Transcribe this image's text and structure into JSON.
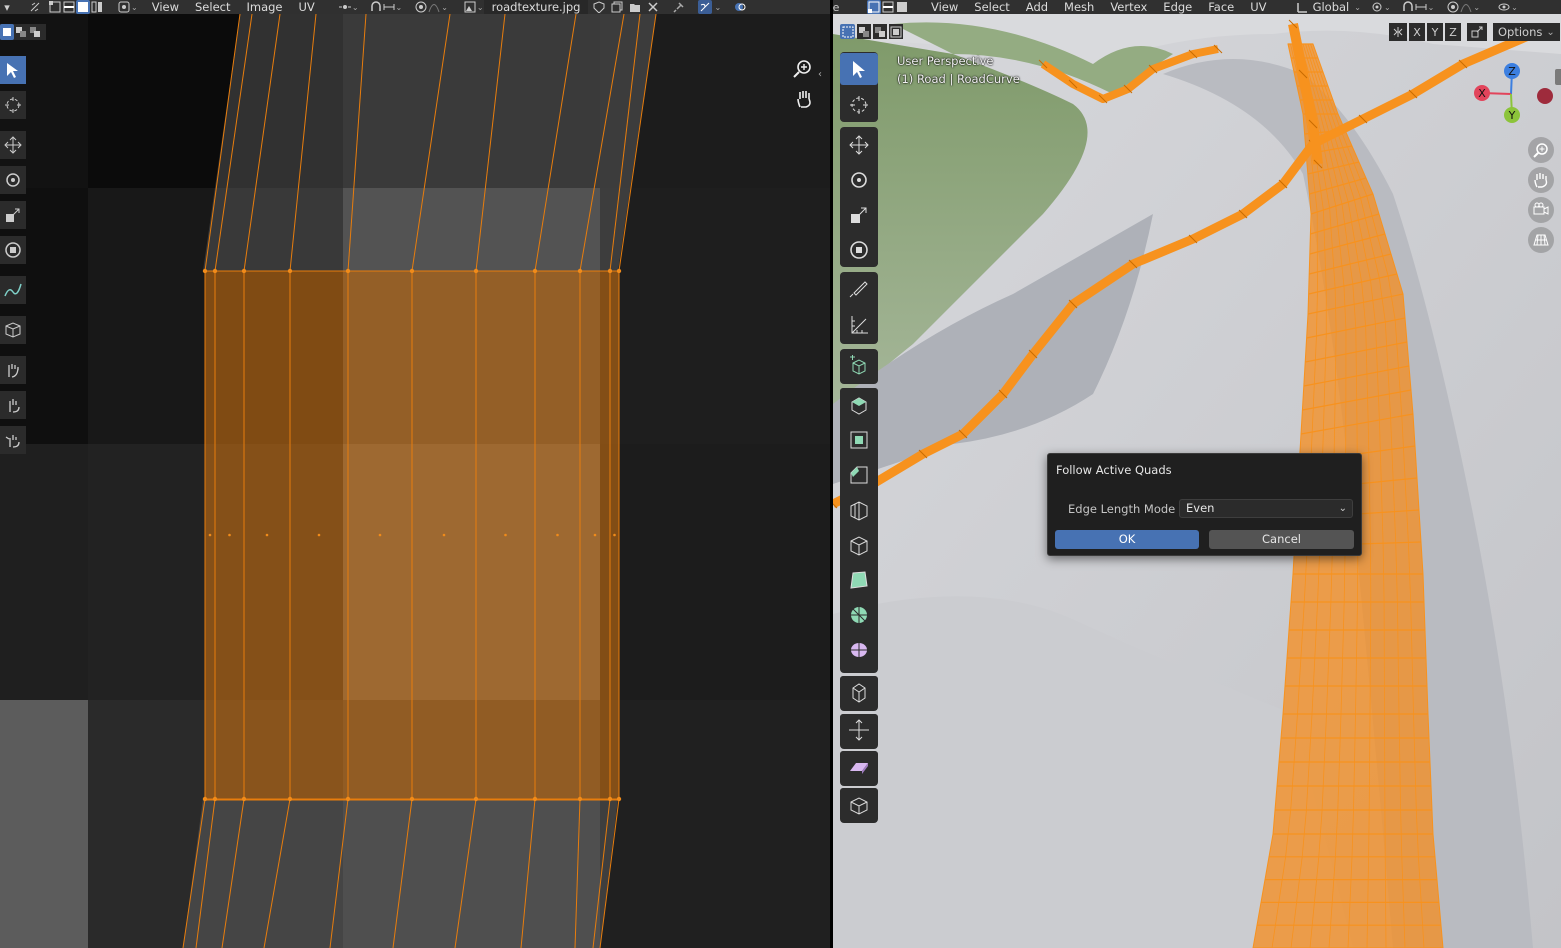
{
  "uv_editor": {
    "menus": [
      "View",
      "Select",
      "Image",
      "UV"
    ],
    "image_name": "roadtexture.jpg",
    "accent_color": "#e87d0d"
  },
  "viewport": {
    "menus": [
      "View",
      "Select",
      "Add",
      "Mesh",
      "Vertex",
      "Edge",
      "Face",
      "UV"
    ],
    "transform_orientation": "Global",
    "axis_buttons": [
      "X",
      "Y",
      "Z"
    ],
    "options_label": "Options",
    "perspective_label": "User Perspective",
    "object_label": "(1) Road | RoadCurve",
    "gizmo": {
      "x": "X",
      "y": "Y",
      "z": "Z",
      "x_color": "#e2445b",
      "y_color": "#8cc43a",
      "z_color": "#3c7fe0"
    }
  },
  "dialog": {
    "title": "Follow Active Quads",
    "field_label": "Edge Length Mode",
    "field_value": "Even",
    "ok_label": "OK",
    "cancel_label": "Cancel"
  },
  "icons": {
    "uv_tools": [
      "select-box-icon",
      "cursor-icon",
      "move-icon",
      "rotate-icon",
      "scale-icon",
      "transform-icon",
      "annotate-icon",
      "rip-region-icon",
      "grab-icon",
      "relax-icon",
      "pinch-icon"
    ],
    "vp_tools": [
      "select-box-icon",
      "cursor-icon",
      "move-icon",
      "rotate-icon",
      "scale-icon",
      "transform-icon",
      "annotate-icon",
      "measure-icon",
      "add-cube-icon",
      "extrude-icon",
      "inset-icon",
      "bevel-icon",
      "loop-cut-icon",
      "knife-icon",
      "poly-build-icon",
      "spin-icon",
      "smooth-icon",
      "edge-slide-icon",
      "shrink-fatten-icon",
      "shear-icon",
      "rip-icon"
    ]
  }
}
